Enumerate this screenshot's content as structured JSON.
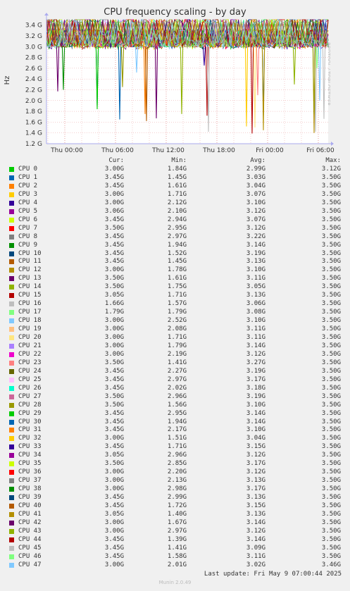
{
  "chart_data": {
    "type": "line",
    "title": "CPU frequency scaling - by day",
    "ylabel": "Hz",
    "side_label": "RRDTOOL / TOBI OETIKER",
    "ylim": [
      1.2,
      3.5
    ],
    "y_ticks": [
      "1.2 G",
      "1.4 G",
      "1.6 G",
      "1.8 G",
      "2.0 G",
      "2.2 G",
      "2.4 G",
      "2.6 G",
      "2.8 G",
      "3.0 G",
      "3.2 G",
      "3.4 G"
    ],
    "x_ticks": [
      "Thu 00:00",
      "Thu 06:00",
      "Thu 12:00",
      "Thu 18:00",
      "Fri 00:00",
      "Fri 06:00"
    ],
    "legend_columns": [
      "Cur:",
      "Min:",
      "Avg:",
      "Max:"
    ],
    "series": [
      {
        "name": "CPU 0",
        "color": "#00cc00",
        "cur": "3.00G",
        "min": "1.84G",
        "avg": "2.99G",
        "max": "3.12G"
      },
      {
        "name": "CPU 1",
        "color": "#0066b3",
        "cur": "3.45G",
        "min": "1.45G",
        "avg": "3.03G",
        "max": "3.50G"
      },
      {
        "name": "CPU 2",
        "color": "#ff8000",
        "cur": "3.45G",
        "min": "1.61G",
        "avg": "3.04G",
        "max": "3.50G"
      },
      {
        "name": "CPU 3",
        "color": "#ffcc00",
        "cur": "3.00G",
        "min": "1.71G",
        "avg": "3.07G",
        "max": "3.50G"
      },
      {
        "name": "CPU 4",
        "color": "#330099",
        "cur": "3.00G",
        "min": "2.12G",
        "avg": "3.10G",
        "max": "3.50G"
      },
      {
        "name": "CPU 5",
        "color": "#990099",
        "cur": "3.06G",
        "min": "2.10G",
        "avg": "3.12G",
        "max": "3.50G"
      },
      {
        "name": "CPU 6",
        "color": "#ccff00",
        "cur": "3.45G",
        "min": "2.94G",
        "avg": "3.07G",
        "max": "3.50G"
      },
      {
        "name": "CPU 7",
        "color": "#ff0000",
        "cur": "3.50G",
        "min": "2.95G",
        "avg": "3.12G",
        "max": "3.50G"
      },
      {
        "name": "CPU 8",
        "color": "#808080",
        "cur": "3.45G",
        "min": "2.97G",
        "avg": "3.22G",
        "max": "3.50G"
      },
      {
        "name": "CPU 9",
        "color": "#008f00",
        "cur": "3.45G",
        "min": "1.94G",
        "avg": "3.14G",
        "max": "3.50G"
      },
      {
        "name": "CPU 10",
        "color": "#00487d",
        "cur": "3.45G",
        "min": "1.52G",
        "avg": "3.19G",
        "max": "3.50G"
      },
      {
        "name": "CPU 11",
        "color": "#b35a00",
        "cur": "3.45G",
        "min": "1.45G",
        "avg": "3.13G",
        "max": "3.50G"
      },
      {
        "name": "CPU 12",
        "color": "#b38f00",
        "cur": "3.00G",
        "min": "1.78G",
        "avg": "3.10G",
        "max": "3.50G"
      },
      {
        "name": "CPU 13",
        "color": "#6b006b",
        "cur": "3.50G",
        "min": "1.61G",
        "avg": "3.11G",
        "max": "3.50G"
      },
      {
        "name": "CPU 14",
        "color": "#8fb300",
        "cur": "3.50G",
        "min": "1.75G",
        "avg": "3.05G",
        "max": "3.50G"
      },
      {
        "name": "CPU 15",
        "color": "#b30000",
        "cur": "3.05G",
        "min": "1.71G",
        "avg": "3.13G",
        "max": "3.50G"
      },
      {
        "name": "CPU 16",
        "color": "#bebebe",
        "cur": "1.66G",
        "min": "1.57G",
        "avg": "3.06G",
        "max": "3.50G"
      },
      {
        "name": "CPU 17",
        "color": "#80ff80",
        "cur": "1.79G",
        "min": "1.79G",
        "avg": "3.08G",
        "max": "3.50G"
      },
      {
        "name": "CPU 18",
        "color": "#80c9ff",
        "cur": "3.00G",
        "min": "2.52G",
        "avg": "3.10G",
        "max": "3.50G"
      },
      {
        "name": "CPU 19",
        "color": "#ffc080",
        "cur": "3.00G",
        "min": "2.08G",
        "avg": "3.11G",
        "max": "3.50G"
      },
      {
        "name": "CPU 20",
        "color": "#ffe680",
        "cur": "3.00G",
        "min": "1.71G",
        "avg": "3.11G",
        "max": "3.50G"
      },
      {
        "name": "CPU 21",
        "color": "#aa80ff",
        "cur": "3.00G",
        "min": "1.79G",
        "avg": "3.14G",
        "max": "3.50G"
      },
      {
        "name": "CPU 22",
        "color": "#ee00cc",
        "cur": "3.00G",
        "min": "2.19G",
        "avg": "3.12G",
        "max": "3.50G"
      },
      {
        "name": "CPU 23",
        "color": "#ff8080",
        "cur": "3.50G",
        "min": "1.41G",
        "avg": "3.27G",
        "max": "3.50G"
      },
      {
        "name": "CPU 24",
        "color": "#666600",
        "cur": "3.45G",
        "min": "2.27G",
        "avg": "3.19G",
        "max": "3.50G"
      },
      {
        "name": "CPU 25",
        "color": "#ffbfff",
        "cur": "3.45G",
        "min": "2.97G",
        "avg": "3.17G",
        "max": "3.50G"
      },
      {
        "name": "CPU 26",
        "color": "#00ffcc",
        "cur": "3.45G",
        "min": "2.02G",
        "avg": "3.18G",
        "max": "3.50G"
      },
      {
        "name": "CPU 27",
        "color": "#cc6699",
        "cur": "3.50G",
        "min": "2.96G",
        "avg": "3.19G",
        "max": "3.50G"
      },
      {
        "name": "CPU 28",
        "color": "#999900",
        "cur": "3.50G",
        "min": "1.56G",
        "avg": "3.10G",
        "max": "3.50G"
      },
      {
        "name": "CPU 29",
        "color": "#00cc00",
        "cur": "3.45G",
        "min": "2.95G",
        "avg": "3.14G",
        "max": "3.50G"
      },
      {
        "name": "CPU 30",
        "color": "#0066b3",
        "cur": "3.45G",
        "min": "1.94G",
        "avg": "3.14G",
        "max": "3.50G"
      },
      {
        "name": "CPU 31",
        "color": "#ff8000",
        "cur": "3.45G",
        "min": "2.17G",
        "avg": "3.10G",
        "max": "3.50G"
      },
      {
        "name": "CPU 32",
        "color": "#ffcc00",
        "cur": "3.00G",
        "min": "1.51G",
        "avg": "3.04G",
        "max": "3.50G"
      },
      {
        "name": "CPU 33",
        "color": "#330099",
        "cur": "3.45G",
        "min": "1.71G",
        "avg": "3.15G",
        "max": "3.50G"
      },
      {
        "name": "CPU 34",
        "color": "#990099",
        "cur": "3.05G",
        "min": "2.96G",
        "avg": "3.12G",
        "max": "3.50G"
      },
      {
        "name": "CPU 35",
        "color": "#ccff00",
        "cur": "3.50G",
        "min": "2.85G",
        "avg": "3.17G",
        "max": "3.50G"
      },
      {
        "name": "CPU 36",
        "color": "#ff0000",
        "cur": "3.00G",
        "min": "2.20G",
        "avg": "3.12G",
        "max": "3.50G"
      },
      {
        "name": "CPU 37",
        "color": "#808080",
        "cur": "3.00G",
        "min": "2.13G",
        "avg": "3.13G",
        "max": "3.50G"
      },
      {
        "name": "CPU 38",
        "color": "#008f00",
        "cur": "3.00G",
        "min": "2.98G",
        "avg": "3.17G",
        "max": "3.50G"
      },
      {
        "name": "CPU 39",
        "color": "#00487d",
        "cur": "3.45G",
        "min": "2.99G",
        "avg": "3.13G",
        "max": "3.50G"
      },
      {
        "name": "CPU 40",
        "color": "#b35a00",
        "cur": "3.45G",
        "min": "1.72G",
        "avg": "3.15G",
        "max": "3.50G"
      },
      {
        "name": "CPU 41",
        "color": "#b38f00",
        "cur": "3.05G",
        "min": "1.40G",
        "avg": "3.13G",
        "max": "3.50G"
      },
      {
        "name": "CPU 42",
        "color": "#6b006b",
        "cur": "3.00G",
        "min": "1.67G",
        "avg": "3.14G",
        "max": "3.50G"
      },
      {
        "name": "CPU 43",
        "color": "#8fb300",
        "cur": "3.00G",
        "min": "2.97G",
        "avg": "3.12G",
        "max": "3.50G"
      },
      {
        "name": "CPU 44",
        "color": "#b30000",
        "cur": "3.45G",
        "min": "1.39G",
        "avg": "3.14G",
        "max": "3.50G"
      },
      {
        "name": "CPU 45",
        "color": "#bebebe",
        "cur": "3.45G",
        "min": "1.41G",
        "avg": "3.09G",
        "max": "3.50G"
      },
      {
        "name": "CPU 46",
        "color": "#80ff80",
        "cur": "3.45G",
        "min": "1.58G",
        "avg": "3.11G",
        "max": "3.50G"
      },
      {
        "name": "CPU 47",
        "color": "#80c9ff",
        "cur": "3.00G",
        "min": "2.01G",
        "avg": "3.02G",
        "max": "3.46G"
      }
    ],
    "dips": [
      {
        "series": "CPU 9",
        "t": 0.06,
        "value": 2.2
      },
      {
        "series": "CPU 13",
        "t": 0.04,
        "value": 2.17
      },
      {
        "series": "CPU 10",
        "t": 0.18,
        "value": 1.9
      },
      {
        "series": "CPU 0",
        "t": 0.18,
        "value": 1.84
      },
      {
        "series": "CPU 1",
        "t": 0.26,
        "value": 1.65
      },
      {
        "series": "CPU 28",
        "t": 0.27,
        "value": 2.25
      },
      {
        "series": "CPU 2",
        "t": 0.35,
        "value": 1.75
      },
      {
        "series": "CPU 11",
        "t": 0.355,
        "value": 1.62
      },
      {
        "series": "CPU 42",
        "t": 0.39,
        "value": 1.67
      },
      {
        "series": "CPU 18",
        "t": 0.32,
        "value": 2.52
      },
      {
        "series": "CPU 14",
        "t": 0.48,
        "value": 1.75
      },
      {
        "series": "CPU 15",
        "t": 0.57,
        "value": 1.72
      },
      {
        "series": "CPU 16",
        "t": 0.575,
        "value": 1.42
      },
      {
        "series": "CPU 33",
        "t": 0.56,
        "value": 2.65
      },
      {
        "series": "CPU 32",
        "t": 0.71,
        "value": 1.52
      },
      {
        "series": "CPU 44",
        "t": 0.73,
        "value": 1.39
      },
      {
        "series": "CPU 20",
        "t": 0.74,
        "value": 1.5
      },
      {
        "series": "CPU 1",
        "t": 0.77,
        "value": 1.72
      },
      {
        "series": "CPU 41",
        "t": 0.77,
        "value": 1.45
      },
      {
        "series": "CPU 23",
        "t": 0.75,
        "value": 2.1
      },
      {
        "series": "CPU 14",
        "t": 0.88,
        "value": 2.3
      },
      {
        "series": "CPU 16",
        "t": 0.955,
        "value": 1.42
      },
      {
        "series": "CPU 41",
        "t": 0.95,
        "value": 1.4
      },
      {
        "series": "CPU 28",
        "t": 0.95,
        "value": 1.75
      },
      {
        "series": "CPU 46",
        "t": 0.96,
        "value": 2.6
      },
      {
        "series": "CPU 47",
        "t": 0.97,
        "value": 2.0
      },
      {
        "series": "CPU 45",
        "t": 0.985,
        "value": 1.66
      }
    ]
  },
  "footer": {
    "last_update": "Last update: Fri May  9 07:00:44 2025",
    "munin": "Munin 2.0.49"
  }
}
